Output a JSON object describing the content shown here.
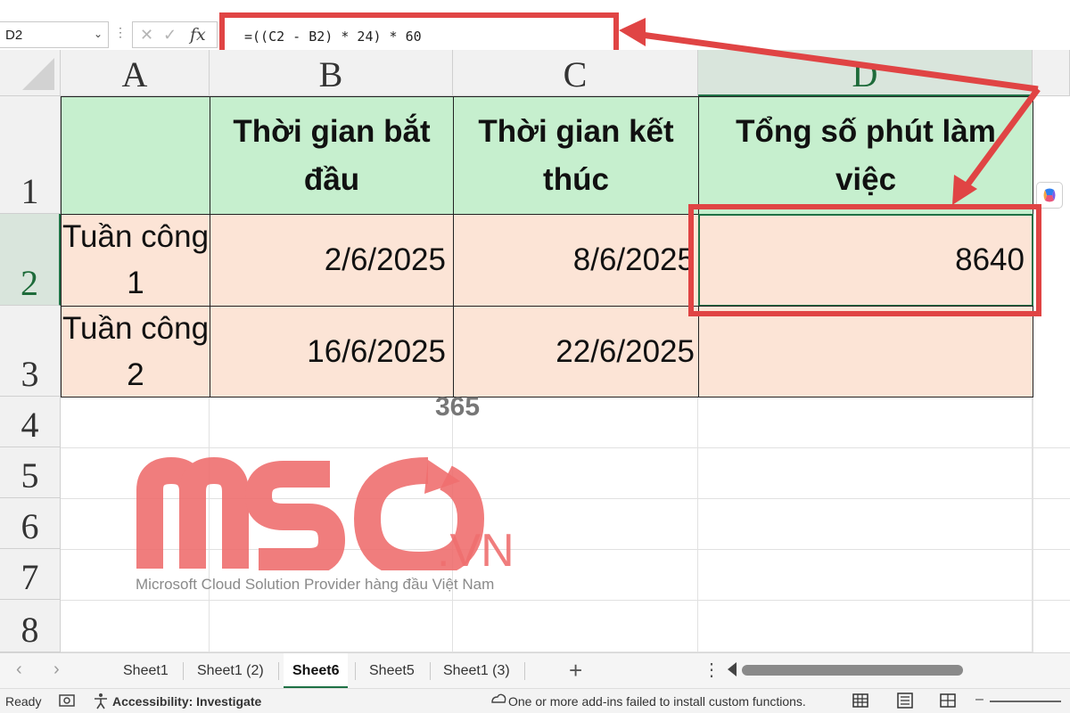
{
  "name_box": {
    "value": "D2"
  },
  "formula_bar": {
    "fx_label": "fx",
    "formula": "=((C2 - B2) * 24) * 60"
  },
  "columns": [
    "A",
    "B",
    "C",
    "D"
  ],
  "rows": [
    "1",
    "2",
    "3",
    "4",
    "5",
    "6",
    "7",
    "8"
  ],
  "active_cell": "D2",
  "table": {
    "header": {
      "a1": "",
      "b1": "Thời gian bắt đầu",
      "c1": "Thời gian kết thúc",
      "d1": "Tổng số phút làm việc"
    },
    "rows": [
      {
        "a": "Tuần công 1",
        "b": "2/6/2025",
        "c": "8/6/2025",
        "d": "8640"
      },
      {
        "a": "Tuần công 2",
        "b": "16/6/2025",
        "c": "22/6/2025",
        "d": ""
      }
    ]
  },
  "colors": {
    "header_fill": "#c6efce",
    "data_fill": "#fce4d6",
    "highlight": "#e04444",
    "excel_green": "#1e7145",
    "watermark_red": "#ef6f6f"
  },
  "watermark": {
    "logo_text": "MSO",
    "superscript": "365",
    "domain": ".VN",
    "tagline": "Microsoft Cloud Solution Provider hàng đầu Việt Nam"
  },
  "sheet_tabs": [
    {
      "label": "Sheet1",
      "active": false
    },
    {
      "label": "Sheet1 (2)",
      "active": false
    },
    {
      "label": "Sheet6",
      "active": true
    },
    {
      "label": "Sheet5",
      "active": false
    },
    {
      "label": "Sheet1 (3)",
      "active": false
    }
  ],
  "status_bar": {
    "ready": "Ready",
    "accessibility": "Accessibility: Investigate",
    "message": "One or more add-ins failed to install custom functions."
  },
  "icons": {
    "name_box_caret": "chevron-down-icon",
    "cancel": "cancel-x-icon",
    "enter": "checkmark-icon",
    "function": "fx-icon",
    "copilot": "copilot-icon",
    "nav_prev": "chevron-left-icon",
    "nav_next": "chevron-right-icon",
    "add_sheet": "plus-icon",
    "normal_view": "grid-view-icon",
    "page_layout": "page-layout-icon",
    "page_break": "page-break-icon"
  }
}
